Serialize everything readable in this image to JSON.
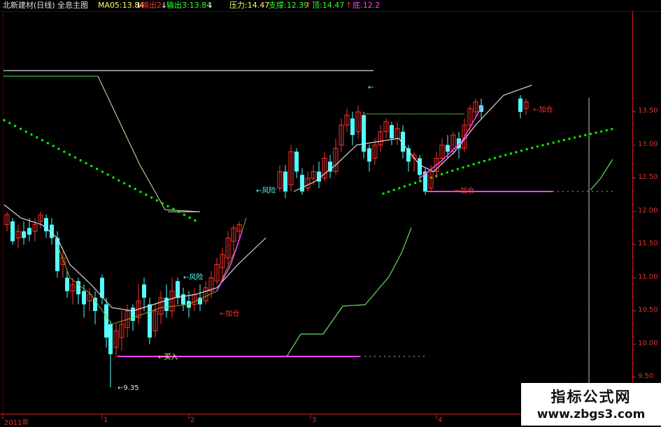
{
  "header": {
    "stock_name": "北新建材(日线)",
    "indicator_name": "全息主图",
    "ma": "MA05:13.84",
    "out2": "输出2:",
    "out3": "输出3:13.84",
    "pressure": "压力:14.47",
    "support": "支撑:12.39",
    "top": "顶:14.47",
    "bottom": "底:12.2"
  },
  "price_axis": {
    "labels": [
      "13.50",
      "13.00",
      "12.50",
      "12.00",
      "11.50",
      "11.00",
      "10.50",
      "10.00",
      "9.50"
    ]
  },
  "date_axis": {
    "labels": [
      "2011年",
      "1",
      "2",
      "3",
      "4"
    ]
  },
  "annotations": {
    "risk_top": "←风险",
    "risk_mid": "←风险",
    "add_top": "←加仓",
    "add_mid": "←加仓",
    "add_low": "←加仓",
    "buy": "←买入",
    "low_price": "←9.35"
  },
  "colors": {
    "up": "#ff3030",
    "down": "#54ffff",
    "ma": "#ffffff",
    "magenta": "#ff40ff",
    "green_dot": "#00ff00",
    "axis_red": "#d02020"
  },
  "watermark": {
    "line1": "指标公式网",
    "line2": "www.zbgs3.com"
  }
}
